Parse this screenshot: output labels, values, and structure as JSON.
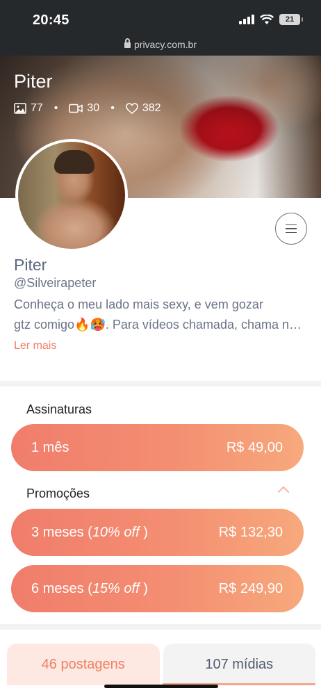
{
  "status_bar": {
    "time": "20:45",
    "battery": "21"
  },
  "browser": {
    "url": "privacy.com.br"
  },
  "cover": {
    "name": "Piter",
    "stats": {
      "photos": "77",
      "videos": "30",
      "likes": "382"
    }
  },
  "profile": {
    "name": "Piter",
    "handle": "@Silveirapeter",
    "bio_line1": "Conheça o meu lado mais sexy, e vem gozar",
    "bio_line2": "gtz comigo🔥🥵. Para vídeos chamada, chama no privado",
    "read_more": "Ler mais"
  },
  "subscriptions": {
    "title": "Assinaturas",
    "plans": [
      {
        "label": "1 mês",
        "price": "R$ 49,00"
      }
    ]
  },
  "promotions": {
    "title": "Promoções",
    "plans": [
      {
        "label_main": "3 meses (",
        "label_discount": "10% off",
        "label_end": " )",
        "price": "R$ 132,30"
      },
      {
        "label_main": "6 meses (",
        "label_discount": "15% off",
        "label_end": " )",
        "price": "R$ 249,90"
      }
    ]
  },
  "tabs": [
    {
      "label": "46 postagens",
      "active": true
    },
    {
      "label": "107 mídias",
      "active": false
    }
  ],
  "colors": {
    "accent": "#f07f62",
    "gradient_start": "#f07d6b",
    "gradient_end": "#f7a97c"
  },
  "icons": [
    "lock-icon",
    "image-icon",
    "video-icon",
    "heart-icon",
    "menu-icon",
    "chevron-up-icon",
    "wifi-icon",
    "signal-icon",
    "battery-icon"
  ]
}
